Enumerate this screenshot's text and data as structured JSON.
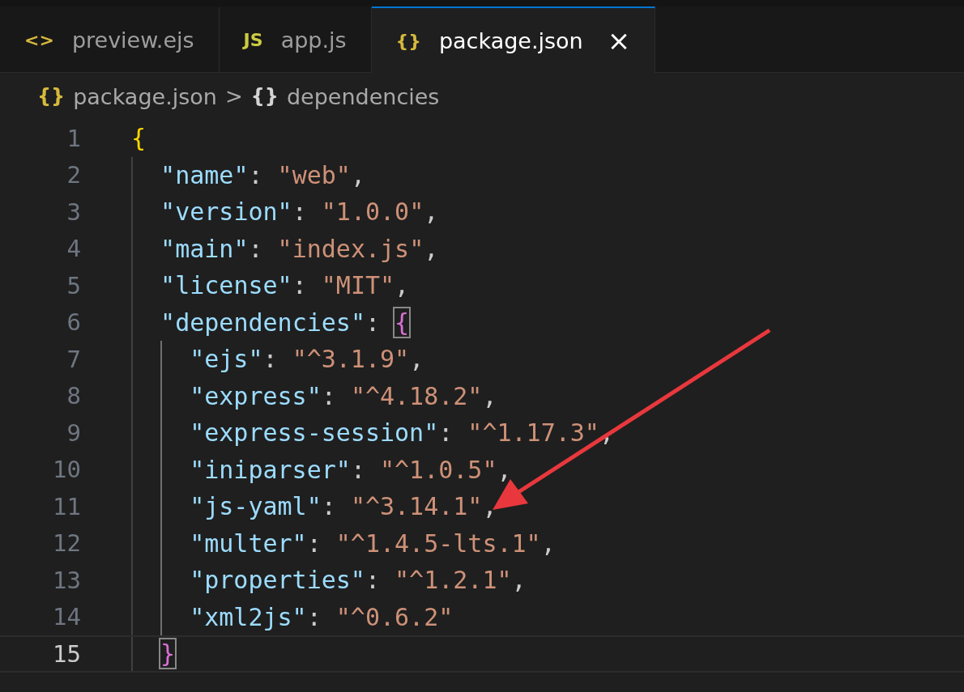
{
  "tabs": [
    {
      "icon": "<>",
      "label": "preview.ejs",
      "selected": false
    },
    {
      "icon": "JS",
      "label": "app.js",
      "selected": false
    },
    {
      "icon": "{}",
      "label": "package.json",
      "selected": true,
      "close": "×"
    }
  ],
  "breadcrumb": [
    {
      "icon": "{}",
      "kind": "file",
      "label": "package.json"
    },
    {
      "icon": "{}",
      "kind": "symbol",
      "label": "dependencies"
    }
  ],
  "breadcrumb_separator": ">",
  "lines": [
    {
      "number": "1",
      "current": false,
      "tokens": [
        {
          "kind": "bracket",
          "text": "{",
          "color": "#ffd700",
          "matched": false
        }
      ]
    },
    {
      "number": "2",
      "current": false,
      "tokens": [
        {
          "kind": "key",
          "text": "  \"name\""
        },
        {
          "kind": "punct",
          "text": ": "
        },
        {
          "kind": "string",
          "text": "\"web\""
        },
        {
          "kind": "punct",
          "text": ","
        }
      ]
    },
    {
      "number": "3",
      "current": false,
      "tokens": [
        {
          "kind": "key",
          "text": "  \"version\""
        },
        {
          "kind": "punct",
          "text": ": "
        },
        {
          "kind": "string",
          "text": "\"1.0.0\""
        },
        {
          "kind": "punct",
          "text": ","
        }
      ]
    },
    {
      "number": "4",
      "current": false,
      "tokens": [
        {
          "kind": "key",
          "text": "  \"main\""
        },
        {
          "kind": "punct",
          "text": ": "
        },
        {
          "kind": "string",
          "text": "\"index.js\""
        },
        {
          "kind": "punct",
          "text": ","
        }
      ]
    },
    {
      "number": "5",
      "current": false,
      "tokens": [
        {
          "kind": "key",
          "text": "  \"license\""
        },
        {
          "kind": "punct",
          "text": ": "
        },
        {
          "kind": "string",
          "text": "\"MIT\""
        },
        {
          "kind": "punct",
          "text": ","
        }
      ]
    },
    {
      "number": "6",
      "current": false,
      "tokens": [
        {
          "kind": "key",
          "text": "  \"dependencies\""
        },
        {
          "kind": "punct",
          "text": ": "
        },
        {
          "kind": "bracket",
          "text": "{",
          "color": "#da70d6",
          "matched": true
        }
      ]
    },
    {
      "number": "7",
      "current": false,
      "tokens": [
        {
          "kind": "key",
          "text": "    \"ejs\""
        },
        {
          "kind": "punct",
          "text": ": "
        },
        {
          "kind": "string",
          "text": "\"^3.1.9\""
        },
        {
          "kind": "punct",
          "text": ","
        }
      ]
    },
    {
      "number": "8",
      "current": false,
      "tokens": [
        {
          "kind": "key",
          "text": "    \"express\""
        },
        {
          "kind": "punct",
          "text": ": "
        },
        {
          "kind": "string",
          "text": "\"^4.18.2\""
        },
        {
          "kind": "punct",
          "text": ","
        }
      ]
    },
    {
      "number": "9",
      "current": false,
      "tokens": [
        {
          "kind": "key",
          "text": "    \"express-session\""
        },
        {
          "kind": "punct",
          "text": ": "
        },
        {
          "kind": "string",
          "text": "\"^1.17.3\""
        },
        {
          "kind": "punct",
          "text": ","
        }
      ]
    },
    {
      "number": "10",
      "current": false,
      "tokens": [
        {
          "kind": "key",
          "text": "    \"iniparser\""
        },
        {
          "kind": "punct",
          "text": ": "
        },
        {
          "kind": "string",
          "text": "\"^1.0.5\""
        },
        {
          "kind": "punct",
          "text": ","
        }
      ]
    },
    {
      "number": "11",
      "current": false,
      "tokens": [
        {
          "kind": "key",
          "text": "    \"js-yaml\""
        },
        {
          "kind": "punct",
          "text": ": "
        },
        {
          "kind": "string",
          "text": "\"^3.14.1\""
        },
        {
          "kind": "punct",
          "text": ","
        }
      ]
    },
    {
      "number": "12",
      "current": false,
      "tokens": [
        {
          "kind": "key",
          "text": "    \"multer\""
        },
        {
          "kind": "punct",
          "text": ": "
        },
        {
          "kind": "string",
          "text": "\"^1.4.5-lts.1\""
        },
        {
          "kind": "punct",
          "text": ","
        }
      ]
    },
    {
      "number": "13",
      "current": false,
      "tokens": [
        {
          "kind": "key",
          "text": "    \"properties\""
        },
        {
          "kind": "punct",
          "text": ": "
        },
        {
          "kind": "string",
          "text": "\"^1.2.1\""
        },
        {
          "kind": "punct",
          "text": ","
        }
      ]
    },
    {
      "number": "14",
      "current": false,
      "tokens": [
        {
          "kind": "key",
          "text": "    \"xml2js\""
        },
        {
          "kind": "punct",
          "text": ": "
        },
        {
          "kind": "string",
          "text": "\"^0.6.2\""
        }
      ]
    },
    {
      "number": "15",
      "current": true,
      "tokens": [
        {
          "kind": "bracket",
          "text": "  }",
          "color": "#da70d6",
          "matched": true
        }
      ]
    }
  ],
  "annotation": {
    "kind": "arrow",
    "color": "#e8383d"
  }
}
